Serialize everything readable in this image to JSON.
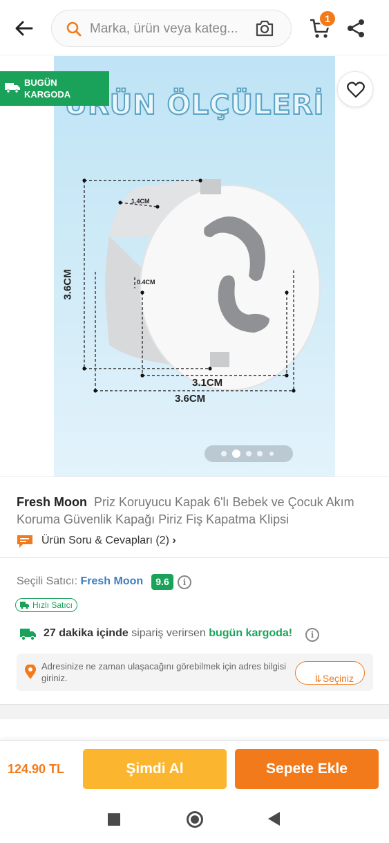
{
  "header": {
    "search_placeholder": "Marka, ürün veya kateg...",
    "cart_count": "1",
    "icons": [
      "back-arrow-icon",
      "search-icon",
      "camera-icon",
      "cart-icon",
      "share-icon"
    ]
  },
  "gallery": {
    "badge": {
      "line1": "BUGÜN",
      "line2": "KARGODA"
    },
    "image_title": "ÜRÜN ÖLÇÜLERİ",
    "dimensions": {
      "height": "3.6CM",
      "depth": "1.4CM",
      "slot": "0.4CM",
      "inner_width": "3.1CM",
      "outer_width": "3.6CM"
    },
    "dots_count": 5,
    "active_dot": 1
  },
  "product": {
    "brand": "Fresh Moon",
    "name": "Priz Koruyucu Kapak 6'lı Bebek ve Çocuk Akım Koruma Güvenlik Kapağı Piriz Fiş Kapatma Klipsi",
    "qa_label": "Ürün Soru & Cevapları (2)"
  },
  "seller": {
    "label": "Seçili Satıcı:",
    "name": "Fresh Moon",
    "score": "9.6",
    "fast_badge": "Hızlı Satıcı",
    "delivery": {
      "time": "27 dakika içinde",
      "middle": "sipariş verirsen",
      "highlight": "bugün kargoda!"
    },
    "address_prompt": "Adresinize ne zaman ulaşacağını görebilmek için adres bilgisi giriniz.",
    "city_button": "İl Seçiniz"
  },
  "bottom_bar": {
    "price": "124.90 TL",
    "buy_now": "Şimdi Al",
    "add_to_cart": "Sepete Ekle"
  },
  "colors": {
    "orange": "#f27a1a",
    "yellow": "#fbb52e",
    "green": "#1ba25a",
    "seller_blue": "#3e7cc2"
  }
}
